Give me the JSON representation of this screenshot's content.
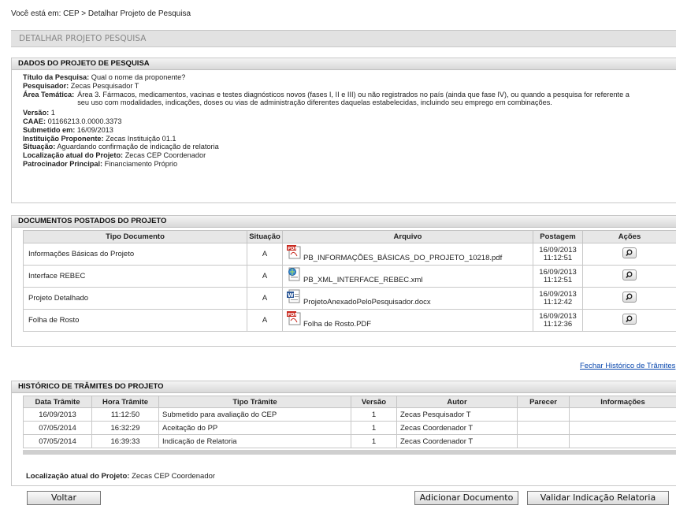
{
  "breadcrumb": "Você está em: CEP > Detalhar Projeto de Pesquisa",
  "page_title": "DETALHAR PROJETO PESQUISA",
  "projeto": {
    "header": "DADOS DO PROJETO DE PESQUISA",
    "titulo_label": "Título da Pesquisa:",
    "titulo_value": "Qual o nome da proponente?",
    "pesquisador_label": "Pesquisador:",
    "pesquisador_value": "Zecas Pesquisador T",
    "area_label": "Área Temática:",
    "area_value": "Área 3. Fármacos, medicamentos, vacinas e testes diagnósticos novos (fases I, II e III) ou não registrados no país (ainda que fase IV), ou quando a pesquisa for referente a seu uso com modalidades, indicações, doses ou vias de administração diferentes daquelas estabelecidas, incluindo seu emprego em combinações.",
    "versao_label": "Versão:",
    "versao_value": "1",
    "caae_label": "CAAE:",
    "caae_value": "01166213.0.0000.3373",
    "submetido_label": "Submetido em:",
    "submetido_value": "16/09/2013",
    "instituicao_label": "Instituição Proponente:",
    "instituicao_value": "Zecas Instituição 01.1",
    "situacao_label": "Situação:",
    "situacao_value": "Aguardando confirmação de indicação de relatoria",
    "localizacao_label": "Localização atual do Projeto:",
    "localizacao_value": "Zecas CEP Coordenador",
    "patrocinador_label": "Patrocinador Principal:",
    "patrocinador_value": "Financiamento Próprio"
  },
  "documentos": {
    "header": "DOCUMENTOS POSTADOS DO PROJETO",
    "columns": [
      "Tipo Documento",
      "Situação",
      "Arquivo",
      "Postagem",
      "Ações"
    ],
    "rows": [
      {
        "tipo": "Informações Básicas do Projeto",
        "situacao": "A",
        "arquivo": "PB_INFORMAÇÕES_BÁSICAS_DO_PROJETO_10218.pdf",
        "icon": "pdf-icon",
        "data": "16/09/2013",
        "hora": "11:12:51"
      },
      {
        "tipo": "Interface REBEC",
        "situacao": "A",
        "arquivo": "PB_XML_INTERFACE_REBEC.xml",
        "icon": "xml-icon",
        "data": "16/09/2013",
        "hora": "11:12:51"
      },
      {
        "tipo": "Projeto Detalhado",
        "situacao": "A",
        "arquivo": "ProjetoAnexadoPeloPesquisador.docx",
        "icon": "word-icon",
        "data": "16/09/2013",
        "hora": "11:12:42"
      },
      {
        "tipo": "Folha de Rosto",
        "situacao": "A",
        "arquivo": "Folha de Rosto.PDF",
        "icon": "pdf-icon",
        "data": "16/09/2013",
        "hora": "11:12:36"
      }
    ]
  },
  "fechar_link": "Fechar Histórico de Trâmites",
  "historico": {
    "header": "HISTÓRICO DE TRÂMITES DO PROJETO",
    "columns": [
      "Data Trâmite",
      "Hora Trâmite",
      "Tipo Trâmite",
      "Versão",
      "Autor",
      "Parecer",
      "Informações"
    ],
    "rows": [
      {
        "data": "16/09/2013",
        "hora": "11:12:50",
        "tipo": "Submetido para avaliação do CEP",
        "versao": "1",
        "autor": "Zecas Pesquisador T",
        "parecer": "",
        "info": ""
      },
      {
        "data": "07/05/2014",
        "hora": "16:32:29",
        "tipo": "Aceitação do PP",
        "versao": "1",
        "autor": "Zecas Coordenador T",
        "parecer": "",
        "info": ""
      },
      {
        "data": "07/05/2014",
        "hora": "16:39:33",
        "tipo": "Indicação de Relatoria",
        "versao": "1",
        "autor": "Zecas Coordenador T",
        "parecer": "",
        "info": ""
      }
    ],
    "localizacao_label": "Localização atual do Projeto:",
    "localizacao_value": "Zecas CEP Coordenador"
  },
  "buttons": {
    "voltar": "Voltar",
    "adicionar": "Adicionar Documento",
    "validar": "Validar Indicação Relatoria"
  }
}
